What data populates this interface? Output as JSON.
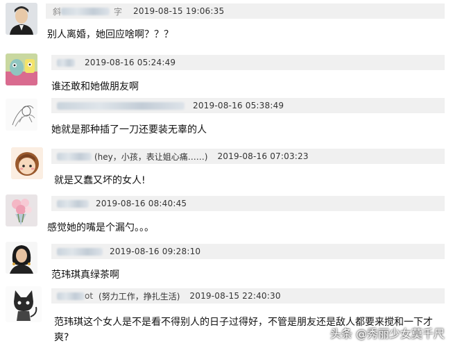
{
  "comments": [
    {
      "avatar_desc": "man-portrait",
      "name_fragment": "斜",
      "name_suffix": "字",
      "signature": "",
      "timestamp": "2019-08-15 19:06:35",
      "text": "别人离婚，她回应啥啊？？？"
    },
    {
      "avatar_desc": "cartoon-character",
      "name_fragment": "",
      "name_suffix": "",
      "signature": "",
      "timestamp": "2019-08-16 05:24:49",
      "text": "谁还敢和她做朋友啊"
    },
    {
      "avatar_desc": "sketch-drawing",
      "name_fragment": "",
      "name_suffix": "",
      "signature": "",
      "timestamp": "2019-08-16 05:38:49",
      "text": "她就是那种插了一刀还要装无辜的人"
    },
    {
      "avatar_desc": "cartoon-girl",
      "name_fragment": "",
      "name_suffix": "",
      "signature": "(hey，小孩，表让姐心痛……)",
      "timestamp": "2019-08-16 07:03:23",
      "text": "就是又蠢又坏的女人!"
    },
    {
      "avatar_desc": "flower-bouquet",
      "name_fragment": "",
      "name_suffix": "",
      "signature": "",
      "timestamp": "2019-08-16 08:40:45",
      "text": "感觉她的嘴是个漏勺。。。"
    },
    {
      "avatar_desc": "woman-portrait",
      "name_fragment": "",
      "name_suffix": "",
      "signature": "",
      "timestamp": "2019-08-16 09:28:10",
      "text": "范玮琪真绿茶啊"
    },
    {
      "avatar_desc": "cat-drawing",
      "name_fragment": "",
      "name_suffix": "ot",
      "signature": "(努力工作，挣扎生活)",
      "timestamp": "2019-08-15 22:40:30",
      "text": "范玮琪这个女人是不是看不得别人的日子过得好，不管是朋友还是敌人都要来搅和一下才爽?"
    }
  ],
  "watermark": "头条 @秀丽少女莫千尺"
}
